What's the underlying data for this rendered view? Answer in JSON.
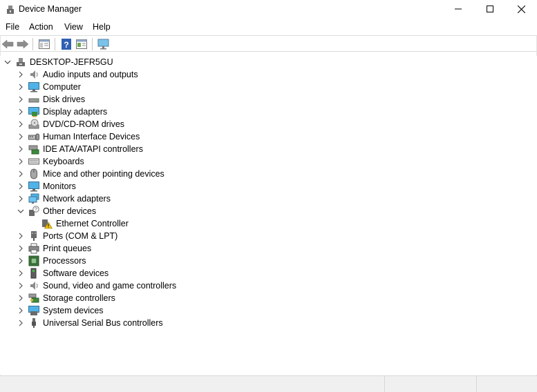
{
  "window": {
    "title": "Device Manager",
    "icons": {
      "app": "device-manager-icon",
      "minimize": "minimize-icon",
      "maximize": "maximize-icon",
      "close": "close-icon"
    }
  },
  "menu": [
    "File",
    "Action",
    "View",
    "Help"
  ],
  "toolbar": [
    "back-arrow-icon",
    "forward-arrow-icon",
    "show-hide-console-tree-icon",
    "help-icon",
    "properties-pane-icon",
    "scan-hardware-icon"
  ],
  "tree": {
    "root": {
      "label": "DESKTOP-JEFR5GU",
      "icon": "computer-node-icon",
      "expanded": true
    },
    "items": [
      {
        "label": "Audio inputs and outputs",
        "icon": "speaker-icon",
        "expanded": false
      },
      {
        "label": "Computer",
        "icon": "monitor-icon",
        "expanded": false
      },
      {
        "label": "Disk drives",
        "icon": "disk-drive-icon",
        "expanded": false
      },
      {
        "label": "Display adapters",
        "icon": "display-adapter-icon",
        "expanded": false
      },
      {
        "label": "DVD/CD-ROM drives",
        "icon": "dvd-drive-icon",
        "expanded": false
      },
      {
        "label": "Human Interface Devices",
        "icon": "hid-icon",
        "expanded": false
      },
      {
        "label": "IDE ATA/ATAPI controllers",
        "icon": "ide-controller-icon",
        "expanded": false
      },
      {
        "label": "Keyboards",
        "icon": "keyboard-icon",
        "expanded": false
      },
      {
        "label": "Mice and other pointing devices",
        "icon": "mouse-icon",
        "expanded": false
      },
      {
        "label": "Monitors",
        "icon": "monitor-icon",
        "expanded": false
      },
      {
        "label": "Network adapters",
        "icon": "network-adapter-icon",
        "expanded": false
      },
      {
        "label": "Other devices",
        "icon": "unknown-device-icon",
        "expanded": true,
        "children": [
          {
            "label": "Ethernet Controller",
            "icon": "warning-device-icon"
          }
        ]
      },
      {
        "label": "Ports (COM & LPT)",
        "icon": "port-icon",
        "expanded": false
      },
      {
        "label": "Print queues",
        "icon": "printer-icon",
        "expanded": false
      },
      {
        "label": "Processors",
        "icon": "processor-icon",
        "expanded": false
      },
      {
        "label": "Software devices",
        "icon": "software-device-icon",
        "expanded": false
      },
      {
        "label": "Sound, video and game controllers",
        "icon": "speaker-icon",
        "expanded": false
      },
      {
        "label": "Storage controllers",
        "icon": "storage-controller-icon",
        "expanded": false
      },
      {
        "label": "System devices",
        "icon": "system-device-icon",
        "expanded": false
      },
      {
        "label": "Universal Serial Bus controllers",
        "icon": "usb-icon",
        "expanded": false
      }
    ]
  }
}
